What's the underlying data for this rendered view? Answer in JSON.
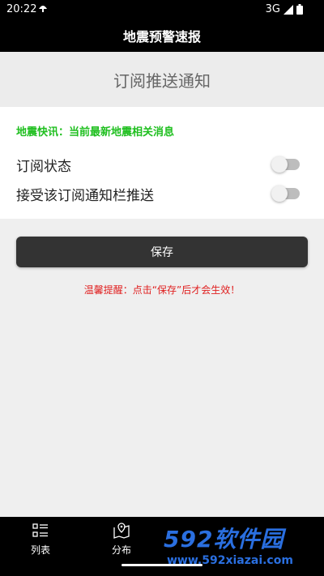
{
  "status": {
    "time": "20:22",
    "network": "3G"
  },
  "app": {
    "title": "地震预警速报"
  },
  "page": {
    "title": "订阅推送通知"
  },
  "card": {
    "quick_news": "地震快讯：当前最新地震相关消息",
    "subscribe_label": "订阅状态",
    "subscribe_on": false,
    "notify_label": "接受该订阅通知栏推送",
    "notify_on": false
  },
  "save_label": "保存",
  "tip": "温馨提醒：点击“保存”后才会生效！",
  "nav": {
    "tab_list": "列表",
    "tab_map": "分布"
  },
  "watermark": {
    "brand": "592软件园",
    "url": "www.592xiazai.com"
  },
  "colors": {
    "accent_green": "#1fbf1f",
    "tip_red": "#e02020",
    "button_dark": "#333333"
  }
}
